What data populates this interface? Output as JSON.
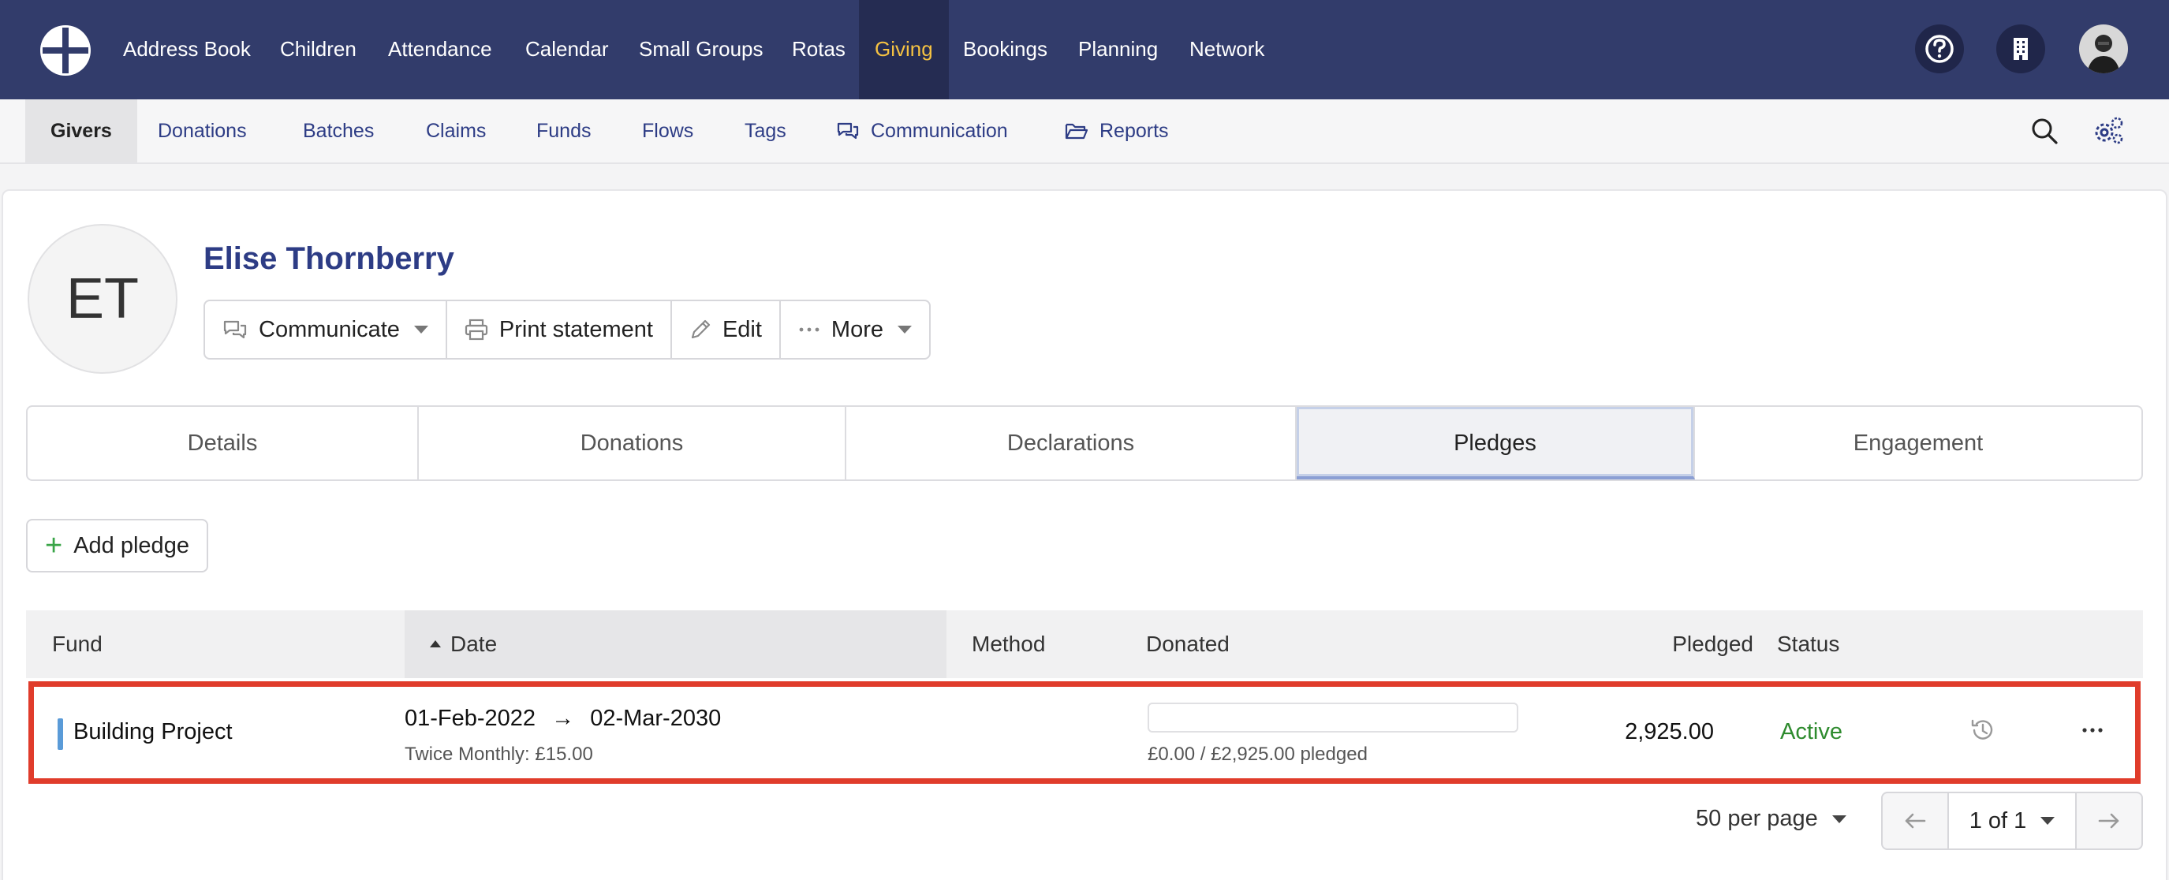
{
  "topnav": {
    "items": [
      "Address Book",
      "Children",
      "Attendance",
      "Calendar",
      "Small Groups",
      "Rotas",
      "Giving",
      "Bookings",
      "Planning",
      "Network"
    ],
    "active": "Giving",
    "active_color": "#f5c242",
    "icons": [
      "help-icon",
      "building-icon",
      "user-avatar"
    ]
  },
  "subnav": {
    "items": [
      "Givers",
      "Donations",
      "Batches",
      "Claims",
      "Funds",
      "Flows",
      "Tags",
      "Communication",
      "Reports"
    ],
    "active": "Givers",
    "icons": [
      "search-icon",
      "settings-icon"
    ]
  },
  "person": {
    "initials": "ET",
    "name": "Elise Thornberry"
  },
  "actions": {
    "communicate": "Communicate",
    "print": "Print statement",
    "edit": "Edit",
    "more": "More"
  },
  "tabs": [
    "Details",
    "Donations",
    "Declarations",
    "Pledges",
    "Engagement"
  ],
  "active_tab": "Pledges",
  "add_pledge": "Add pledge",
  "table": {
    "headers": {
      "fund": "Fund",
      "date": "Date",
      "method": "Method",
      "donated": "Donated",
      "pledged": "Pledged",
      "status": "Status"
    },
    "rows": [
      {
        "fund": "Building Project",
        "date_start": "01-Feb-2022",
        "arrow": "→",
        "date_end": "02-Mar-2030",
        "frequency": "Twice Monthly: £15.00",
        "method": "",
        "donated_text": "£0.00 / £2,925.00 pledged",
        "donated_fraction": 0,
        "pledged": "2,925.00",
        "status": "Active"
      }
    ]
  },
  "pagination": {
    "per_page": "50 per page",
    "page": "1 of 1"
  }
}
